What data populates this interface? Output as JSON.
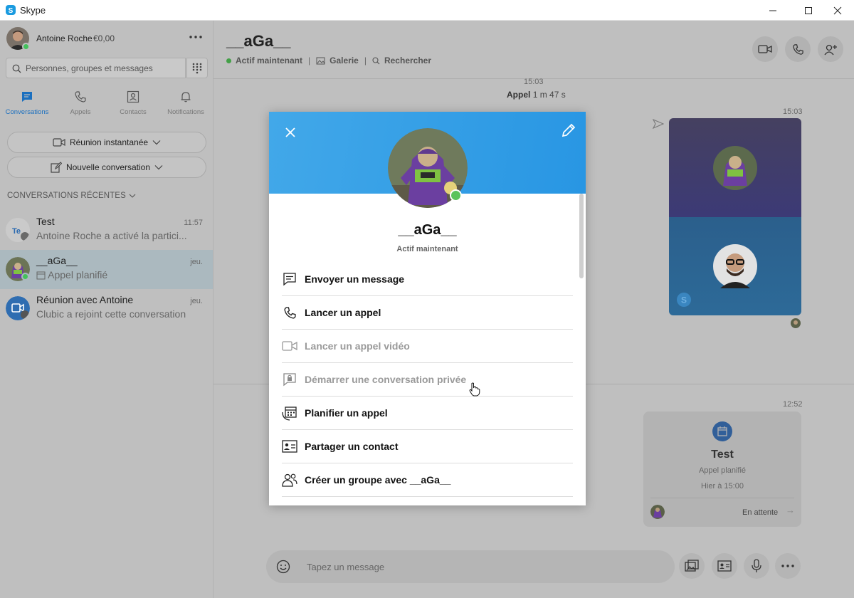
{
  "window": {
    "title": "Skype",
    "controls": [
      "minimize",
      "maximize",
      "close"
    ]
  },
  "profile": {
    "name": "Antoine Roche",
    "credit": "€0,00",
    "presence": "online"
  },
  "search": {
    "placeholder": "Personnes, groupes et messages"
  },
  "nav": {
    "tabs": [
      {
        "label": "Conversations",
        "icon": "chat-icon",
        "active": true
      },
      {
        "label": "Appels",
        "icon": "phone-icon"
      },
      {
        "label": "Contacts",
        "icon": "contacts-icon"
      },
      {
        "label": "Notifications",
        "icon": "bell-icon"
      }
    ]
  },
  "actions": {
    "meet_now": "Réunion instantanée",
    "new_chat": "Nouvelle conversation"
  },
  "recent": {
    "header": "CONVERSATIONS RÉCENTES",
    "items": [
      {
        "name": "Test",
        "last": "Antoine Roche a activé la partici...",
        "time": "11:57",
        "initials": "Te"
      },
      {
        "name": "__aGa__",
        "last": "Appel planifié",
        "time": "jeu.",
        "selected": true
      },
      {
        "name": "Réunion avec Antoine",
        "last": "Clubic a rejoint cette conversation",
        "time": "jeu."
      }
    ]
  },
  "chat": {
    "title": "__aGa__",
    "status": "Actif maintenant",
    "gallery": "Galerie",
    "find": "Rechercher",
    "call_time": "15:03",
    "call_label": "Appel",
    "call_duration": "1 m 47 s",
    "video_time": "15:03",
    "plan_time": "12:52",
    "scheduled": {
      "title": "Test",
      "subtitle": "Appel planifié",
      "when": "Hier à 15:00",
      "status": "En attente"
    },
    "composer_placeholder": "Tapez un message"
  },
  "dialog": {
    "name": "__aGa__",
    "status": "Actif maintenant",
    "actions": [
      {
        "label": "Envoyer un message",
        "icon": "message-icon",
        "enabled": true
      },
      {
        "label": "Lancer un appel",
        "icon": "phone-icon",
        "enabled": true
      },
      {
        "label": "Lancer un appel vidéo",
        "icon": "video-icon",
        "enabled": false
      },
      {
        "label": "Démarrer une conversation privée",
        "icon": "lock-chat-icon",
        "enabled": false
      },
      {
        "label": "Planifier un appel",
        "icon": "calendar-icon",
        "enabled": true
      },
      {
        "label": "Partager un contact",
        "icon": "contact-card-icon",
        "enabled": true
      },
      {
        "label": "Créer un groupe avec __aGa__",
        "icon": "group-icon",
        "enabled": true
      }
    ]
  },
  "colors": {
    "accent": "#1a6fbf",
    "header_gradient_start": "#42a8e9",
    "header_gradient_end": "#2896e3",
    "presence": "#43c15b",
    "dim_overlay": "#bfbfbf"
  }
}
